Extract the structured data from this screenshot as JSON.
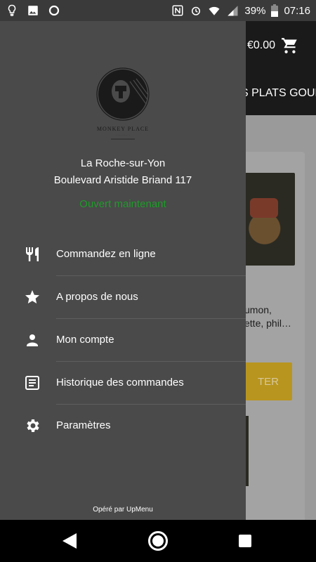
{
  "status_bar": {
    "battery": "39%",
    "time": "07:16",
    "icons_left": [
      "lightbulb-icon",
      "image-icon",
      "circle-icon"
    ],
    "icons_right": [
      "nfc-icon",
      "alarm-icon",
      "wifi-icon",
      "signal-icon",
      "battery-icon"
    ]
  },
  "app": {
    "cart_total": "€0.00",
    "tab_label": "S PLATS GOURI",
    "card_desc_line1": "umon,",
    "card_desc_line2": "ette, phil…",
    "add_button_label": "TER"
  },
  "drawer": {
    "logo_name": "MONKEY PLACE",
    "city": "La Roche-sur-Yon",
    "street": "Boulevard Aristide Briand 117",
    "open_status": "Ouvert maintenant",
    "menu": [
      {
        "label": "Commandez en ligne",
        "icon": "fork-knife-icon"
      },
      {
        "label": "A propos de nous",
        "icon": "star-icon"
      },
      {
        "label": "Mon compte",
        "icon": "person-icon"
      },
      {
        "label": "Historique des commandes",
        "icon": "receipt-icon"
      },
      {
        "label": "Paramètres",
        "icon": "gear-icon"
      }
    ],
    "powered_by": "Opéré par  UpMenu"
  },
  "colors": {
    "drawer_bg": "#4a4a4a",
    "open_green": "#1f9a2a",
    "accent_yellow": "#b8951e"
  }
}
